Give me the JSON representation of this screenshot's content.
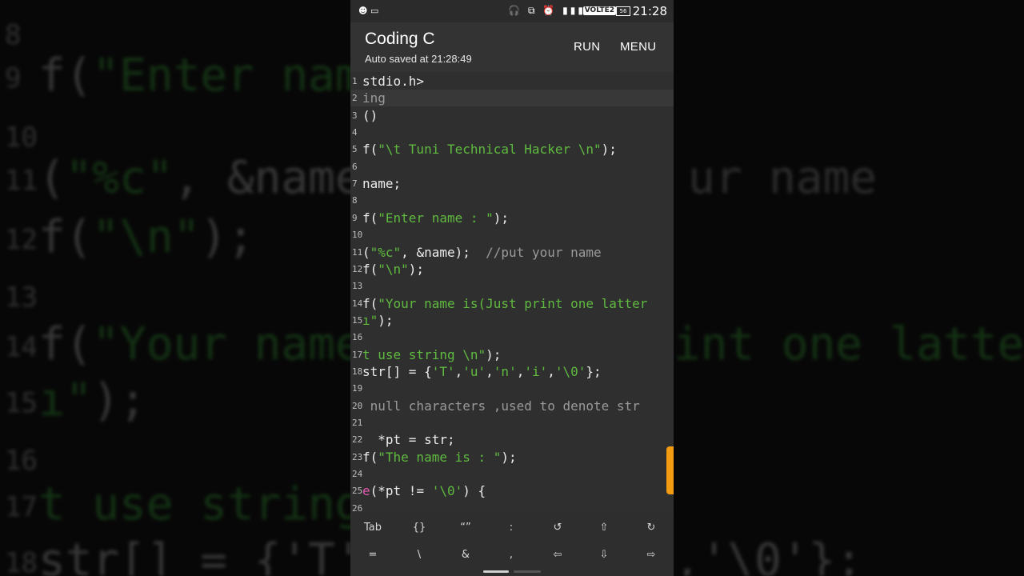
{
  "backdrop": {
    "lines": [
      {
        "num": "8",
        "pre": "",
        "str": "",
        "post": ""
      },
      {
        "num": "9",
        "pre": "f(",
        "str": "\"Enter nam",
        "post": ""
      },
      {
        "num": "10",
        "pre": "",
        "str": "",
        "post": ""
      },
      {
        "num": "11",
        "pre": "(",
        "str": "\"%c\"",
        "post": ", &name"
      },
      {
        "num": "12",
        "pre": "f(",
        "str": "\"\\n\"",
        "post": ");"
      },
      {
        "num": "13",
        "pre": "",
        "str": "",
        "post": ""
      },
      {
        "num": "14",
        "pre": "f(",
        "str": "\"Your name",
        "post": ""
      },
      {
        "num": "15",
        "pre": "",
        "str": "ı\"",
        "post": ");"
      },
      {
        "num": "16",
        "pre": "",
        "str": "",
        "post": ""
      },
      {
        "num": "17",
        "pre": "",
        "str": "t use string",
        "post": ""
      },
      {
        "num": "18",
        "pre": "str[] = {'T'",
        "str": "",
        "post": ""
      }
    ],
    "right_fragments": [
      "ur name",
      "int one latter",
      ",'\\0'};"
    ]
  },
  "status_bar": {
    "left_icons": "☻ ▭",
    "icons": "🎧 ⧉ ⏰ ▮▮▮",
    "network": "VOLTE2",
    "battery": "56",
    "time": "21:28"
  },
  "app_bar": {
    "title": "Coding C",
    "subtitle": "Auto saved at 21:28:49",
    "run_label": "RUN",
    "menu_label": "MENU"
  },
  "editor": {
    "current_line": 2,
    "lines": [
      {
        "n": "1",
        "segs": [
          {
            "t": "stdio.h>",
            "c": ""
          }
        ]
      },
      {
        "n": "2",
        "segs": [
          {
            "t": "ing",
            "c": "c"
          }
        ]
      },
      {
        "n": "3",
        "segs": [
          {
            "t": "()",
            "c": ""
          }
        ]
      },
      {
        "n": "4",
        "segs": []
      },
      {
        "n": "5",
        "segs": [
          {
            "t": "f(",
            "c": ""
          },
          {
            "t": "\"\\t Tuni Technical Hacker \\n\"",
            "c": "s"
          },
          {
            "t": ");",
            "c": ""
          }
        ]
      },
      {
        "n": "6",
        "segs": []
      },
      {
        "n": "7",
        "segs": [
          {
            "t": "name;",
            "c": ""
          }
        ]
      },
      {
        "n": "8",
        "segs": []
      },
      {
        "n": "9",
        "segs": [
          {
            "t": "f(",
            "c": ""
          },
          {
            "t": "\"Enter name : \"",
            "c": "s"
          },
          {
            "t": ");",
            "c": ""
          }
        ]
      },
      {
        "n": "10",
        "segs": []
      },
      {
        "n": "11",
        "segs": [
          {
            "t": "(",
            "c": ""
          },
          {
            "t": "\"%c\"",
            "c": "s"
          },
          {
            "t": ", &name);  ",
            "c": ""
          },
          {
            "t": "//put your name",
            "c": "c"
          }
        ]
      },
      {
        "n": "12",
        "segs": [
          {
            "t": "f(",
            "c": ""
          },
          {
            "t": "\"\\n\"",
            "c": "s"
          },
          {
            "t": ");",
            "c": ""
          }
        ]
      },
      {
        "n": "13",
        "segs": []
      },
      {
        "n": "14",
        "segs": [
          {
            "t": "f(",
            "c": ""
          },
          {
            "t": "\"Your name is(Just print one latter",
            "c": "s"
          }
        ]
      },
      {
        "n": "15",
        "segs": [
          {
            "t": "ı\"",
            "c": "s"
          },
          {
            "t": ");",
            "c": ""
          }
        ]
      },
      {
        "n": "16",
        "segs": []
      },
      {
        "n": "17",
        "segs": [
          {
            "t": "t use string \\n\"",
            "c": "s"
          },
          {
            "t": ");",
            "c": ""
          }
        ]
      },
      {
        "n": "18",
        "segs": [
          {
            "t": "str[] = {",
            "c": ""
          },
          {
            "t": "'T'",
            "c": "s"
          },
          {
            "t": ",",
            "c": ""
          },
          {
            "t": "'u'",
            "c": "s"
          },
          {
            "t": ",",
            "c": ""
          },
          {
            "t": "'n'",
            "c": "s"
          },
          {
            "t": ",",
            "c": ""
          },
          {
            "t": "'i'",
            "c": "s"
          },
          {
            "t": ",",
            "c": ""
          },
          {
            "t": "'\\0'",
            "c": "s"
          },
          {
            "t": "};",
            "c": ""
          }
        ]
      },
      {
        "n": "19",
        "segs": []
      },
      {
        "n": "20",
        "segs": [
          {
            "t": " null characters ,used to denote str",
            "c": "c"
          }
        ]
      },
      {
        "n": "21",
        "segs": []
      },
      {
        "n": "22",
        "segs": [
          {
            "t": "  *pt = str;",
            "c": ""
          }
        ]
      },
      {
        "n": "23",
        "segs": [
          {
            "t": "f(",
            "c": ""
          },
          {
            "t": "\"The name is : \"",
            "c": "s"
          },
          {
            "t": ");",
            "c": ""
          }
        ]
      },
      {
        "n": "24",
        "segs": []
      },
      {
        "n": "25",
        "segs": [
          {
            "t": "e",
            "c": "k"
          },
          {
            "t": "(*pt != ",
            "c": ""
          },
          {
            "t": "'\\0'",
            "c": "s"
          },
          {
            "t": ") {",
            "c": ""
          }
        ]
      },
      {
        "n": "26",
        "segs": []
      }
    ]
  },
  "keyboard": {
    "row1": [
      "Tab",
      "{}",
      "“”",
      ":",
      "↺",
      "⇧",
      "↻"
    ],
    "row2": [
      "=",
      "\\",
      "&",
      ",",
      "⇦",
      "⇩",
      "⇨"
    ]
  }
}
